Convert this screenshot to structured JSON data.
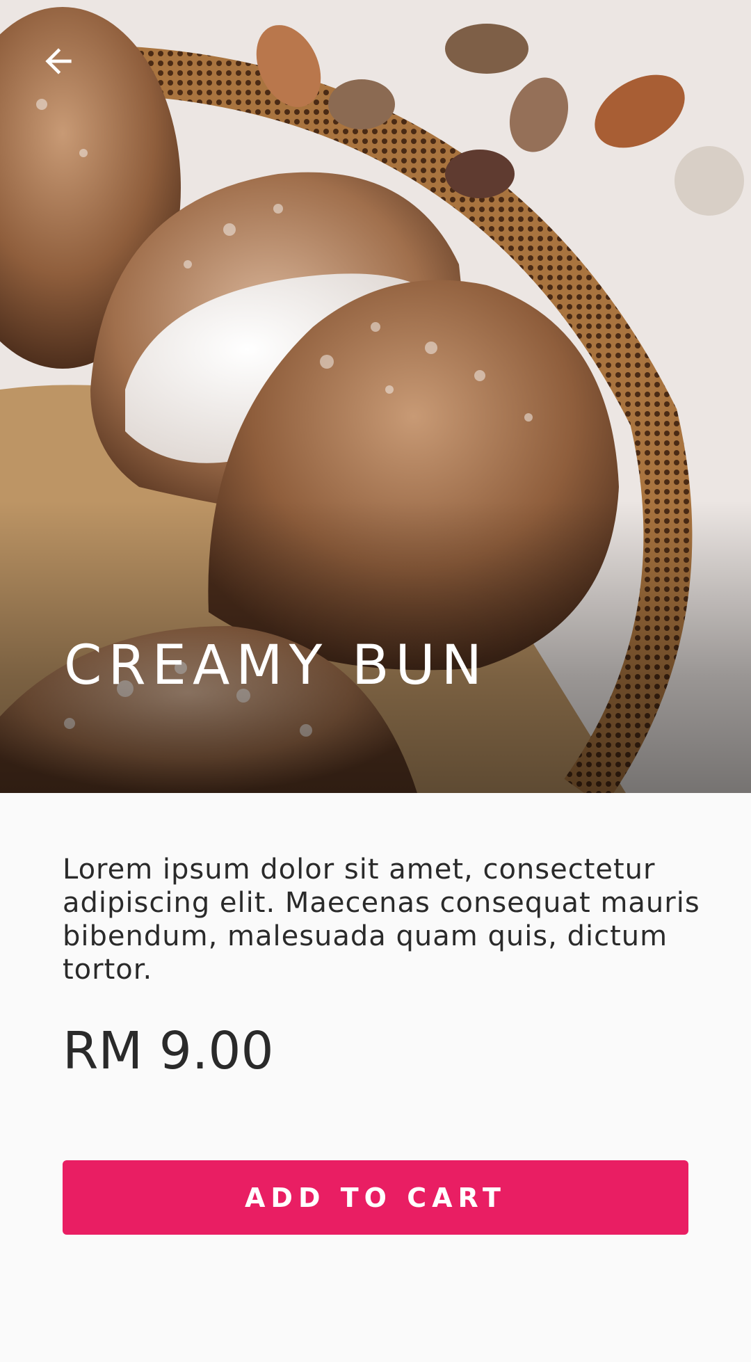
{
  "product": {
    "title": "CREAMY BUN",
    "description": "Lorem ipsum dolor sit amet, consectetur adipiscing elit. Maecenas consequat mauris bibendum, malesuada quam quis, dictum tortor.",
    "price": "RM 9.00"
  },
  "actions": {
    "add_to_cart_label": "ADD TO CART"
  },
  "icons": {
    "back": "arrow-left-icon"
  },
  "colors": {
    "accent": "#e91e63",
    "text": "#2a2a2a",
    "background": "#fafafa",
    "overlay_text": "#ffffff"
  }
}
